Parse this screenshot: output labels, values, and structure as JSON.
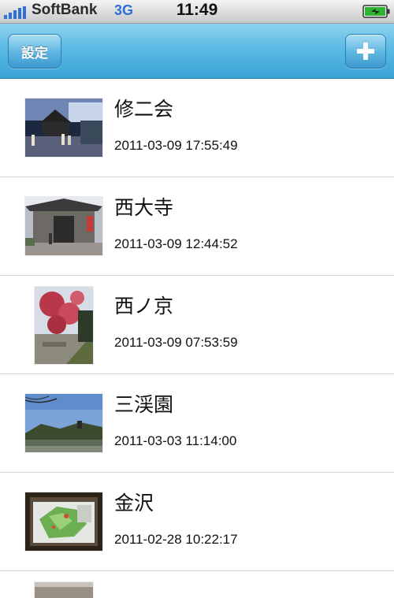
{
  "status_bar": {
    "carrier": "SoftBank",
    "network": "3G",
    "time": "11:49",
    "signal_icon": "signal-bars-icon",
    "battery_icon": "battery-charging-icon",
    "battery_color": "#2fb52f"
  },
  "nav_bar": {
    "settings_label": "設定",
    "add_icon": "plus-icon",
    "color": "#4ab3e0"
  },
  "entries": [
    {
      "title": "修二会",
      "date": "2011-03-09 17:55:49"
    },
    {
      "title": "西大寺",
      "date": "2011-03-09 12:44:52"
    },
    {
      "title": "西ノ京",
      "date": "2011-03-09 07:53:59"
    },
    {
      "title": "三渓園",
      "date": "2011-03-03 11:14:00"
    },
    {
      "title": "金沢",
      "date": "2011-02-28 10:22:17"
    }
  ]
}
